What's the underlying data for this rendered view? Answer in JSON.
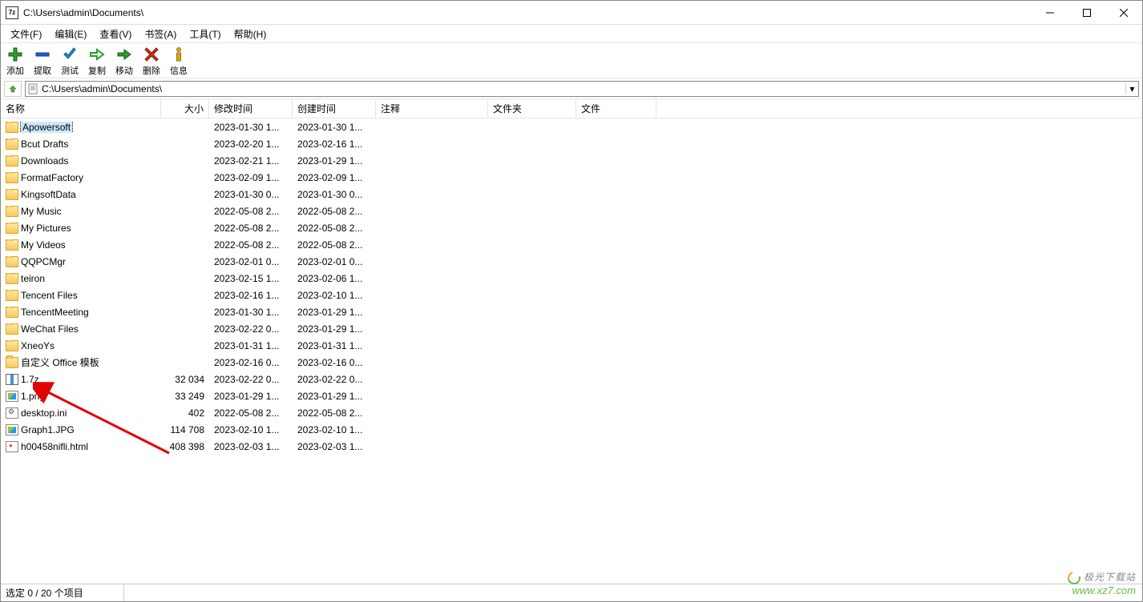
{
  "window": {
    "title": "C:\\Users\\admin\\Documents\\",
    "app_icon_text": "7z"
  },
  "menu": [
    {
      "label": "文件(F)"
    },
    {
      "label": "编辑(E)"
    },
    {
      "label": "查看(V)"
    },
    {
      "label": "书签(A)"
    },
    {
      "label": "工具(T)"
    },
    {
      "label": "帮助(H)"
    }
  ],
  "toolbar": [
    {
      "label": "添加",
      "icon": "plus",
      "color": "#2e9e2e"
    },
    {
      "label": "提取",
      "icon": "minus",
      "color": "#1a5fd6"
    },
    {
      "label": "测试",
      "icon": "check",
      "color": "#1a8fd6"
    },
    {
      "label": "复制",
      "icon": "arrow-right-hollow",
      "color": "#2e9e2e"
    },
    {
      "label": "移动",
      "icon": "arrow-right-solid",
      "color": "#2e9e2e"
    },
    {
      "label": "删除",
      "icon": "cross",
      "color": "#d62a1a"
    },
    {
      "label": "信息",
      "icon": "info",
      "color": "#d6a51a"
    }
  ],
  "path": "C:\\Users\\admin\\Documents\\",
  "columns": [
    {
      "key": "name",
      "label": "名称"
    },
    {
      "key": "size",
      "label": "大小"
    },
    {
      "key": "mtime",
      "label": "修改时间"
    },
    {
      "key": "ctime",
      "label": "创建时间"
    },
    {
      "key": "comment",
      "label": "注释"
    },
    {
      "key": "folders",
      "label": "文件夹"
    },
    {
      "key": "files",
      "label": "文件"
    }
  ],
  "files": [
    {
      "name": "Apowersoft",
      "type": "folder",
      "size": "",
      "mtime": "2023-01-30 1...",
      "ctime": "2023-01-30 1...",
      "selected": true
    },
    {
      "name": "Bcut Drafts",
      "type": "folder",
      "size": "",
      "mtime": "2023-02-20 1...",
      "ctime": "2023-02-16 1..."
    },
    {
      "name": "Downloads",
      "type": "folder",
      "size": "",
      "mtime": "2023-02-21 1...",
      "ctime": "2023-01-29 1..."
    },
    {
      "name": "FormatFactory",
      "type": "folder",
      "size": "",
      "mtime": "2023-02-09 1...",
      "ctime": "2023-02-09 1..."
    },
    {
      "name": "KingsoftData",
      "type": "folder",
      "size": "",
      "mtime": "2023-01-30 0...",
      "ctime": "2023-01-30 0..."
    },
    {
      "name": "My Music",
      "type": "folder",
      "size": "",
      "mtime": "2022-05-08 2...",
      "ctime": "2022-05-08 2..."
    },
    {
      "name": "My Pictures",
      "type": "folder",
      "size": "",
      "mtime": "2022-05-08 2...",
      "ctime": "2022-05-08 2..."
    },
    {
      "name": "My Videos",
      "type": "folder",
      "size": "",
      "mtime": "2022-05-08 2...",
      "ctime": "2022-05-08 2..."
    },
    {
      "name": "QQPCMgr",
      "type": "folder",
      "size": "",
      "mtime": "2023-02-01 0...",
      "ctime": "2023-02-01 0..."
    },
    {
      "name": "teiron",
      "type": "folder",
      "size": "",
      "mtime": "2023-02-15 1...",
      "ctime": "2023-02-06 1..."
    },
    {
      "name": "Tencent Files",
      "type": "folder",
      "size": "",
      "mtime": "2023-02-16 1...",
      "ctime": "2023-02-10 1..."
    },
    {
      "name": "TencentMeeting",
      "type": "folder",
      "size": "",
      "mtime": "2023-01-30 1...",
      "ctime": "2023-01-29 1..."
    },
    {
      "name": "WeChat Files",
      "type": "folder",
      "size": "",
      "mtime": "2023-02-22 0...",
      "ctime": "2023-01-29 1..."
    },
    {
      "name": "XneoYs",
      "type": "folder",
      "size": "",
      "mtime": "2023-01-31 1...",
      "ctime": "2023-01-31 1..."
    },
    {
      "name": "自定义 Office 模板",
      "type": "folder",
      "size": "",
      "mtime": "2023-02-16 0...",
      "ctime": "2023-02-16 0..."
    },
    {
      "name": "1.7z",
      "type": "archive",
      "size": "32 034",
      "mtime": "2023-02-22 0...",
      "ctime": "2023-02-22 0..."
    },
    {
      "name": "1.png",
      "type": "image",
      "size": "33 249",
      "mtime": "2023-01-29 1...",
      "ctime": "2023-01-29 1..."
    },
    {
      "name": "desktop.ini",
      "type": "ini",
      "size": "402",
      "mtime": "2022-05-08 2...",
      "ctime": "2022-05-08 2..."
    },
    {
      "name": "Graph1.JPG",
      "type": "image",
      "size": "114 708",
      "mtime": "2023-02-10 1...",
      "ctime": "2023-02-10 1..."
    },
    {
      "name": "h00458nifli.html",
      "type": "html",
      "size": "408 398",
      "mtime": "2023-02-03 1...",
      "ctime": "2023-02-03 1..."
    }
  ],
  "status": "选定 0 / 20 个项目",
  "watermark": {
    "line1": "极光下载站",
    "line2": "www.xz7.com"
  }
}
